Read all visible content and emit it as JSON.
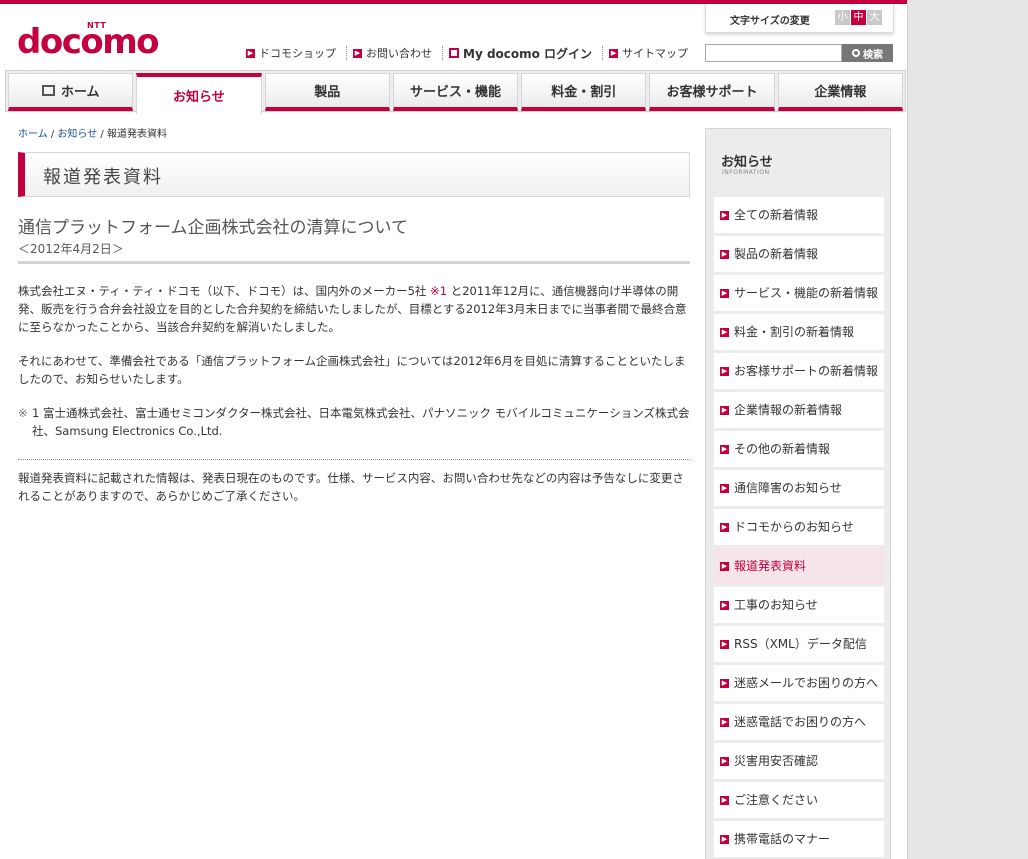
{
  "header": {
    "logo_ntt": "NTT",
    "logo_name": "docomo",
    "fontsize_label": "文字サイズの変更",
    "fontsize_options": [
      "小",
      "中",
      "大"
    ],
    "util_links": [
      "ドコモショップ",
      "お問い合わせ",
      "My docomo ログイン",
      "サイトマップ"
    ],
    "search_button": "検索",
    "search_value": ""
  },
  "nav": {
    "tabs": [
      "ホーム",
      "お知らせ",
      "製品",
      "サービス・機能",
      "料金・割引",
      "お客様サポート",
      "企業情報"
    ]
  },
  "breadcrumb": {
    "home": "ホーム",
    "sep1": " / ",
    "news": "お知らせ",
    "sep2": " / ",
    "current": "報道発表資料"
  },
  "main": {
    "page_title": "報道発表資料",
    "article_title": "通信プラットフォーム企画株式会社の清算について",
    "article_date": "＜2012年4月2日＞",
    "para1_a": "株式会社エヌ・ティ・ティ・ドコモ（以下、ドコモ）は、国内外のメーカー5社 ",
    "para1_ref": "※1",
    "para1_b": " と2011年12月に、通信機器向け半導体の開発、販売を行う合弁会社設立を目的とした合弁契約を締結いたしましたが、目標とする2012年3月末日までに当事者間で最終合意に至らなかったことから、当該合弁契約を解消いたしました。",
    "para2": "それにあわせて、準備会社である「通信プラットフォーム企画株式会社」については2012年6月を目処に清算することといたしましたので、お知らせいたします。",
    "note_mark": "※",
    "note_text": "1 富士通株式会社、富士通セミコンダクター株式会社、日本電気株式会社、パナソニック モバイルコミュニケーションズ株式会社、Samsung Electronics Co.,Ltd.",
    "disclaimer": "報道発表資料に記載された情報は、発表日現在のものです。仕様、サービス内容、お問い合わせ先などの内容は予告なしに変更されることがありますので、あらかじめご了承ください。"
  },
  "sidebar": {
    "title": "お知らせ",
    "subtitle": "INFORMATION",
    "items": [
      "全ての新着情報",
      "製品の新着情報",
      "サービス・機能の新着情報",
      "料金・割引の新着情報",
      "お客様サポートの新着情報",
      "企業情報の新着情報",
      "その他の新着情報",
      "通信障害のお知らせ",
      "ドコモからのお知らせ",
      "報道発表資料",
      "工事のお知らせ",
      "RSS（XML）データ配信",
      "迷惑メールでお困りの方へ",
      "迷惑電話でお困りの方へ",
      "災害用安否確認",
      "ご注意ください",
      "携帯電話のマナー"
    ],
    "active_index": 9
  },
  "colors": {
    "brand": "#c5003e"
  }
}
